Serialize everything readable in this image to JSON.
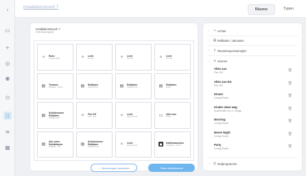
{
  "header": {
    "title": "Installationstouch 7",
    "tabs": [
      {
        "label": "Räume",
        "active": true
      },
      {
        "label": "Typen",
        "active": false
      }
    ]
  },
  "rail": {
    "icons": [
      "back-icon",
      "image-icon",
      "plus-icon",
      "settings-icon",
      "record-icon",
      "target-icon",
      "panel-icon",
      "list-icon",
      "grid-icon"
    ]
  },
  "device": {
    "name": "Installationstouch 7",
    "sub": "KNX Bediengerät"
  },
  "tiles": [
    {
      "icon": "bulb-icon",
      "title": "Ruhe",
      "sub": "Ausgeschaltet"
    },
    {
      "icon": "bulb-icon",
      "title": "Licht",
      "sub": "Flur EG"
    },
    {
      "icon": "bulb-icon",
      "title": "Licht",
      "sub": "Flur EG"
    },
    {
      "icon": "bulb-icon",
      "title": "Licht",
      "sub": "Flur EG"
    },
    {
      "icon": "blind-icon",
      "title": "Terrasse",
      "sub": "Rollladen · Küche"
    },
    {
      "icon": "blind-icon",
      "title": "Rollladen",
      "sub": "Wohnzimmer"
    },
    {
      "icon": "blind-icon",
      "title": "Rollladen",
      "sub": "Schlafzimmer"
    },
    {
      "icon": "blind-icon",
      "title": "Rollladen",
      "sub": "Küche"
    },
    {
      "icon": "blind-icon",
      "title": "Schlafzimmer Rollladen",
      "sub": "Schlafzimmer"
    },
    {
      "icon": "bulb-icon",
      "title": "Flur EG",
      "sub": "Licht · Flur"
    },
    {
      "icon": "bulb-icon",
      "title": "Licht",
      "sub": "Wohnzimmer"
    },
    {
      "icon": "display-icon",
      "title": "Alles aus",
      "sub": "Szene"
    },
    {
      "icon": "blind-icon",
      "title": "Alle unten Schlafräume",
      "sub": "Rollladen · Alle"
    },
    {
      "icon": "blind-icon",
      "title": "Schlafzimmer Rollladen",
      "sub": "Schlafzimmer"
    },
    {
      "icon": "bulb-icon",
      "title": "Licht",
      "sub": "Wohnzimmer"
    },
    {
      "icon": "dark-icon",
      "title": "Kaffeemaschine",
      "sub": "Steckdose · Küche"
    }
  ],
  "actions": {
    "discard_label": "← Änderungen verwerfen",
    "update_label": "Panel aktualisieren"
  },
  "side": {
    "categories": [
      {
        "label": "Lichter",
        "icon": "bulb-icon"
      },
      {
        "label": "Rollläden / Jalousien",
        "icon": "blind-icon"
      },
      {
        "label": "Raumtemperaturregler",
        "icon": "thermostat-icon"
      },
      {
        "label": "Szenen",
        "icon": "scene-icon"
      }
    ],
    "scenes": [
      {
        "name": "Alles aus",
        "room": "Flur EG"
      },
      {
        "name": "Alles aus EG",
        "room": "Flur EG"
      },
      {
        "name": "Dinner",
        "room": "Living Room"
      },
      {
        "name": "Kinder oben weg",
        "room": "Außerhalb von 1. Etage"
      },
      {
        "name": "Morning",
        "room": "Living Room"
      },
      {
        "name": "Movie Night",
        "room": "Living Room"
      },
      {
        "name": "Party",
        "room": "Living Room"
      }
    ],
    "footer_category": {
      "label": "Zeitprogramme",
      "icon": "clock-icon"
    }
  }
}
